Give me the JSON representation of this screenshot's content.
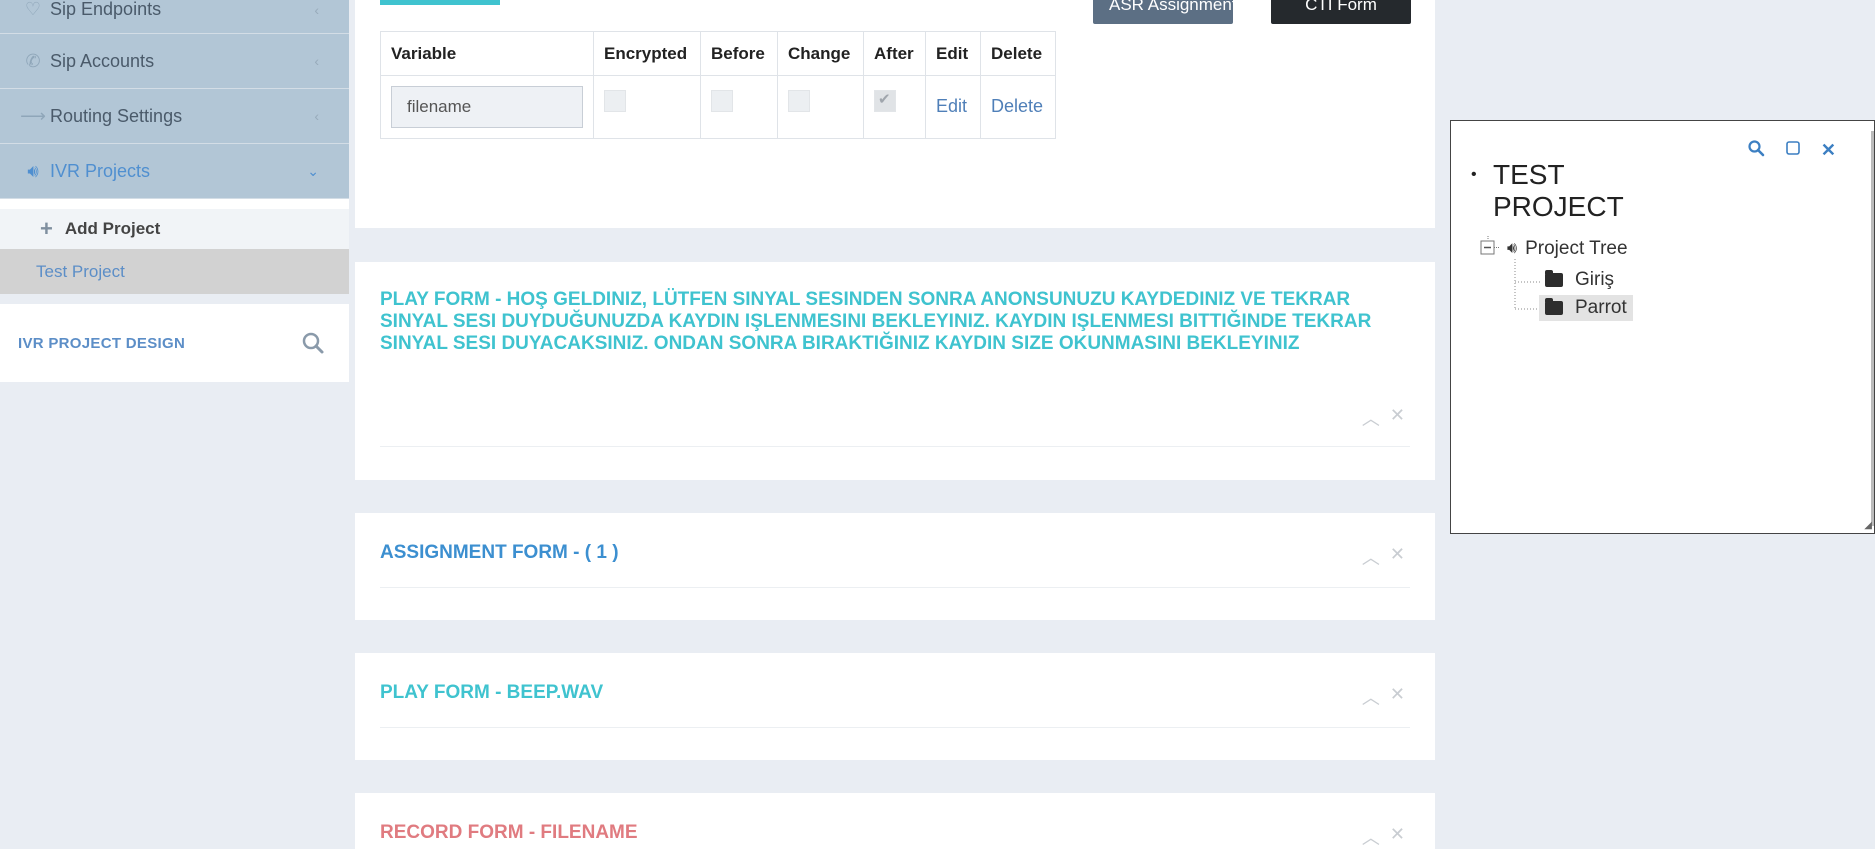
{
  "sidebar": {
    "items": [
      {
        "label": "Sip Endpoints",
        "icon": "heart-icon"
      },
      {
        "label": "Sip Accounts",
        "icon": "phone-icon"
      },
      {
        "label": "Routing Settings",
        "icon": "arrow-right-icon"
      },
      {
        "label": "IVR Projects",
        "icon": "volume-icon"
      }
    ],
    "sub_add": "Add Project",
    "sub_test": "Test Project",
    "design_title": "IVR PROJECT DESIGN"
  },
  "top": {
    "asr_button": "ASR Assignment",
    "cti_button": "CTI Form"
  },
  "variables": {
    "headers": [
      "Variable",
      "Encrypted",
      "Before",
      "Change",
      "After",
      "Edit",
      "Delete"
    ],
    "rows": [
      {
        "variable": "filename",
        "encrypted": false,
        "before": false,
        "change": false,
        "after": true,
        "edit": "Edit",
        "delete": "Delete"
      }
    ]
  },
  "forms": [
    {
      "title": "PLAY FORM - HOŞ GELDINIZ, LÜTFEN SINYAL SESINDEN SONRA ANONSUNUZU KAYDEDINIZ VE TEKRAR SINYAL SESI DUYDUĞUNUZDA KAYDIN IŞLENMESINI BEKLEYINIZ. KAYDIN IŞLENMESI BITTIĞINDE TEKRAR SINYAL SESI DUYACAKSINIZ. ONDAN SONRA BIRAKTIĞINIZ KAYDIN SIZE OKUNMASINI BEKLEYINIZ",
      "color": "#3fc3cf"
    },
    {
      "title": "ASSIGNMENT FORM - ( 1 )",
      "color": "#3c8fd0"
    },
    {
      "title": "PLAY FORM - BEEP.WAV",
      "color": "#3fc3cf"
    },
    {
      "title": "RECORD FORM - FILENAME",
      "color": "#e07b80"
    }
  ],
  "tree": {
    "project": "TEST PROJECT",
    "root": "Project Tree",
    "nodes": [
      "Giriş",
      "Parrot"
    ],
    "selected": "Parrot"
  },
  "colors": {
    "accent": "#3fc3cf",
    "link": "#4f7fb8",
    "sidebar_bg": "#b2c6d6"
  }
}
